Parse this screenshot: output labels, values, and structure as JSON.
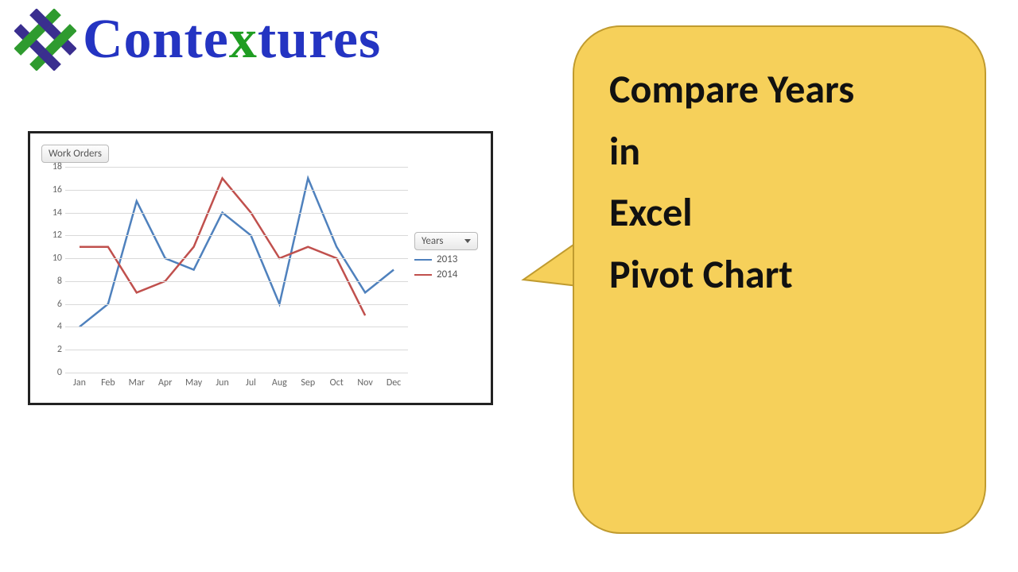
{
  "brand": {
    "name_pre": "Conte",
    "name_x": "x",
    "name_post": "tures"
  },
  "bubble": {
    "line1": "Compare Years",
    "line2": "in",
    "line3": "Excel",
    "line4": "Pivot Chart"
  },
  "chart": {
    "title_button": "Work Orders",
    "legend_filter": "Years"
  },
  "chart_data": {
    "type": "line",
    "title": "Work Orders",
    "xlabel": "",
    "ylabel": "",
    "ylim": [
      0,
      18
    ],
    "yticks": [
      0,
      2,
      4,
      6,
      8,
      10,
      12,
      14,
      16,
      18
    ],
    "categories": [
      "Jan",
      "Feb",
      "Mar",
      "Apr",
      "May",
      "Jun",
      "Jul",
      "Aug",
      "Sep",
      "Oct",
      "Nov",
      "Dec"
    ],
    "series": [
      {
        "name": "2013",
        "color": "#4f81bd",
        "values": [
          4,
          6,
          15,
          10,
          9,
          14,
          12,
          6,
          17,
          11,
          7,
          9
        ]
      },
      {
        "name": "2014",
        "color": "#c0504d",
        "values": [
          11,
          11,
          7,
          8,
          11,
          17,
          14,
          10,
          11,
          10,
          5,
          null
        ]
      }
    ]
  }
}
